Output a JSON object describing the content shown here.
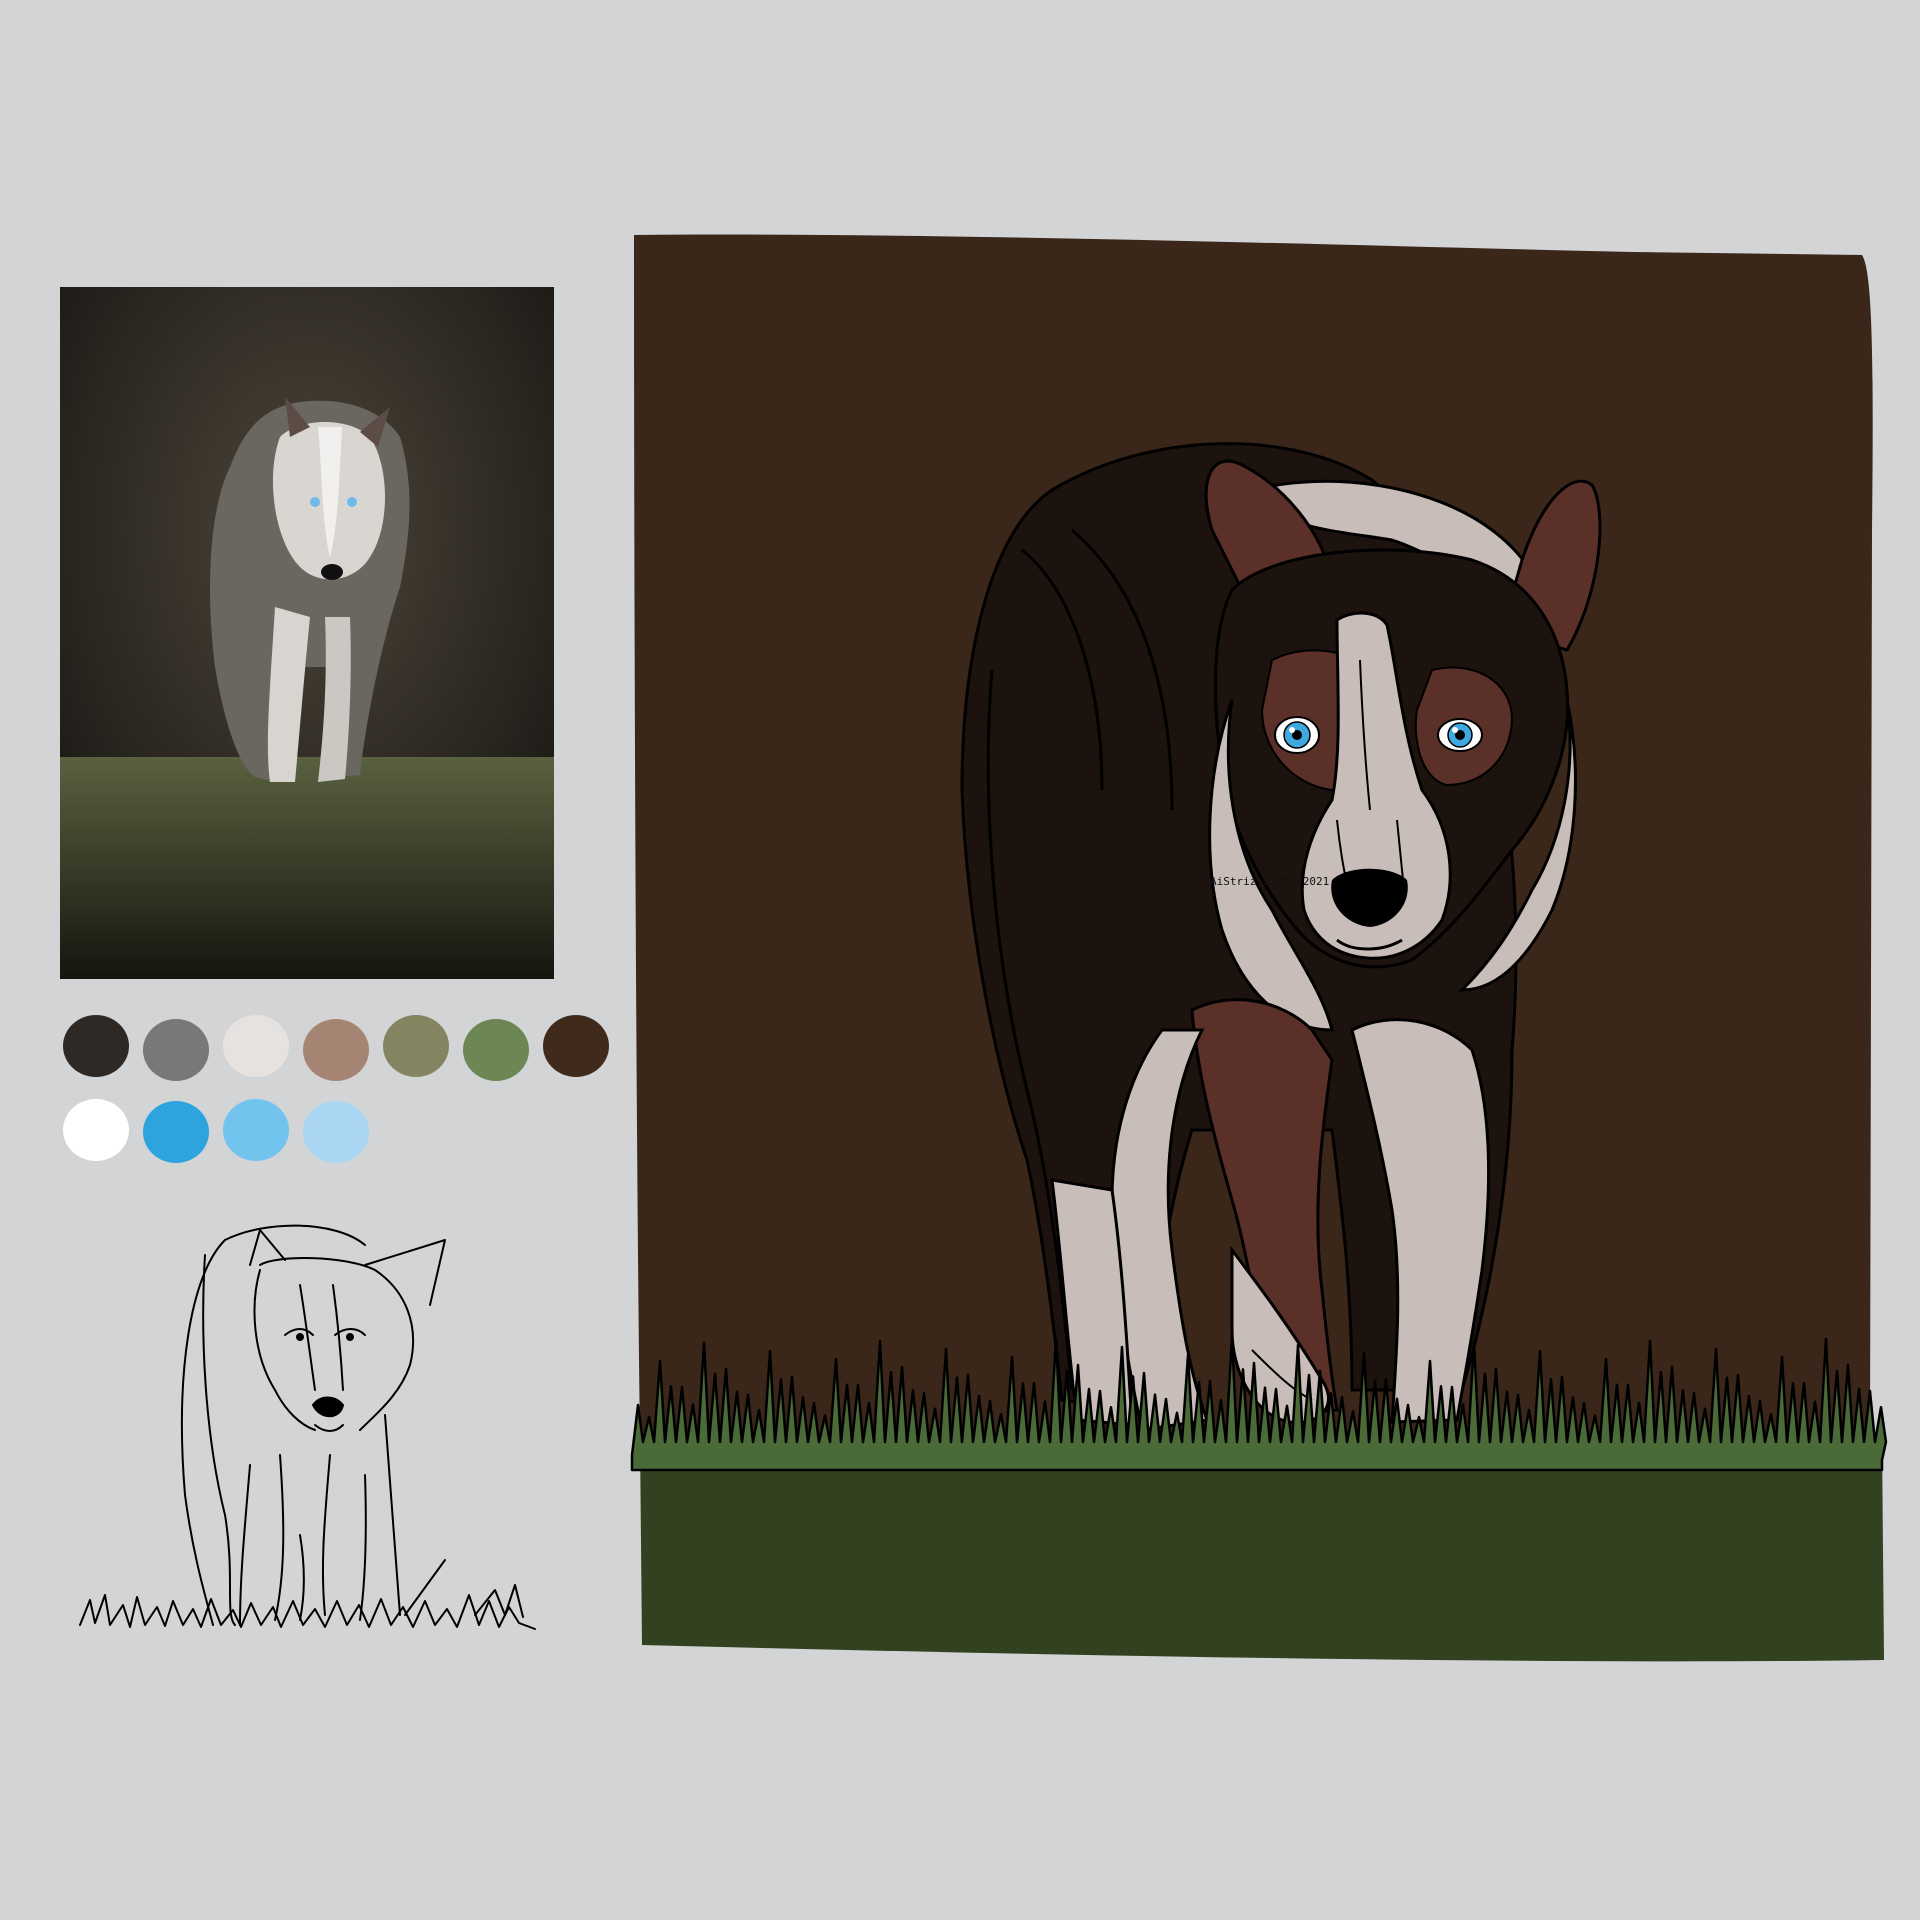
{
  "page": {
    "background": "#d3d4d6"
  },
  "reference_photo": {
    "icon": "dog-photo-icon",
    "colors": {
      "background": "#2b2721",
      "grass": "#4b5132",
      "coat": "#c9c5c1"
    }
  },
  "palette": {
    "swatches": [
      {
        "color": "#2f2926"
      },
      {
        "color": "#7a7876"
      },
      {
        "color": "#e6e2df"
      },
      {
        "color": "#a68474"
      },
      {
        "color": "#858461"
      },
      {
        "color": "#6c8754"
      },
      {
        "color": "#3f2a1c"
      },
      {
        "color": "#ffffff"
      },
      {
        "color": "#2da4de"
      },
      {
        "color": "#72c4ef"
      },
      {
        "color": "#a9d7f1"
      }
    ]
  },
  "sketch": {
    "icon": "dog-line-sketch-icon"
  },
  "artwork": {
    "icon": "dog-illustration-icon",
    "colors": {
      "background": "#3a271a",
      "grass": "#324220",
      "grass_blades": "#4a6a38",
      "coat_dark": "#1c120e",
      "coat_brown": "#5a3028",
      "coat_light": "#c8bdb9",
      "eye": "#3fa8df",
      "outline": "#000000"
    },
    "signature": "AiStriz\n27/02/2021"
  }
}
